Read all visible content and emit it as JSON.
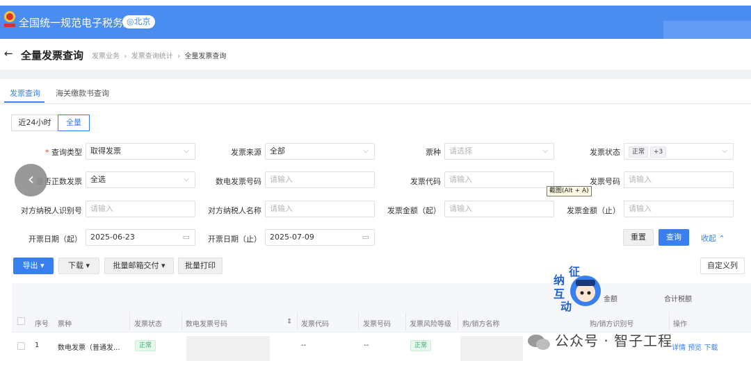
{
  "header": {
    "site_title": "全国统一规范电子税务局",
    "region": "北京"
  },
  "page": {
    "title": "全量发票查询",
    "back_icon": "arrow-left-icon",
    "breadcrumb": [
      "发票业务",
      "发票查询统计",
      "全量发票查询"
    ]
  },
  "tabs": [
    {
      "label": "发票查询",
      "active": true
    },
    {
      "label": "海关缴款书查询",
      "active": false
    }
  ],
  "time_range": {
    "options": [
      "近24小时",
      "全量"
    ],
    "selected": "全量"
  },
  "filters": {
    "query_type": {
      "label": "查询类型",
      "value": "取得发票"
    },
    "invoice_source": {
      "label": "发票来源",
      "value": "全部"
    },
    "ticket_kind": {
      "label": "票种",
      "placeholder": "请选择"
    },
    "invoice_status": {
      "label": "发票状态",
      "tag": "正常",
      "more": "+3"
    },
    "is_positive": {
      "label": "是否正数发票",
      "value": "全选"
    },
    "digital_invoice_no": {
      "label": "数电发票号码",
      "placeholder": "请输入"
    },
    "invoice_code": {
      "label": "发票代码",
      "placeholder": "请输入"
    },
    "invoice_no": {
      "label": "发票号码",
      "placeholder": "请输入"
    },
    "counterparty_id": {
      "label": "对方纳税人识别号",
      "placeholder": "请输入"
    },
    "counterparty_name": {
      "label": "对方纳税人名称",
      "placeholder": "请输入"
    },
    "amount_from": {
      "label": "发票金额（起）",
      "placeholder": "请输入"
    },
    "amount_to": {
      "label": "发票金额（止）",
      "placeholder": "请输入"
    },
    "date_from": {
      "label": "开票日期（起）",
      "value": "2025-06-23"
    },
    "date_to": {
      "label": "开票日期（止）",
      "value": "2025-07-09"
    }
  },
  "tooltip": "截图(Alt + A)",
  "actions": {
    "reset": "重置",
    "query": "查询",
    "collapse": "收起",
    "export": "导出",
    "download": "下载",
    "batch_mail": "批量邮箱交付",
    "batch_print": "批量打印",
    "custom_columns": "自定义列"
  },
  "summary": {
    "amount": "金额",
    "tax": "合计税额"
  },
  "table": {
    "columns": [
      "序号",
      "票种",
      "发票状态",
      "数电发票号码",
      "发票代码",
      "发票号码",
      "发票风险等级",
      "购/销方名称",
      "购/销方识别号",
      "操作"
    ],
    "rows": [
      {
        "index": "1",
        "kind": "数电发票（普通发...",
        "status": "正常",
        "code": "--",
        "number": "--",
        "risk": "正常",
        "ops": [
          "详情",
          "预览",
          "下载"
        ]
      }
    ]
  },
  "mascot": {
    "chars": [
      "征",
      "纳",
      "互",
      "动"
    ]
  },
  "watermark": "公众号 · 智子工程",
  "colors": {
    "brand_blue": "#4a8cf0",
    "primary": "#3a7ff0",
    "success": "#2fae61"
  }
}
